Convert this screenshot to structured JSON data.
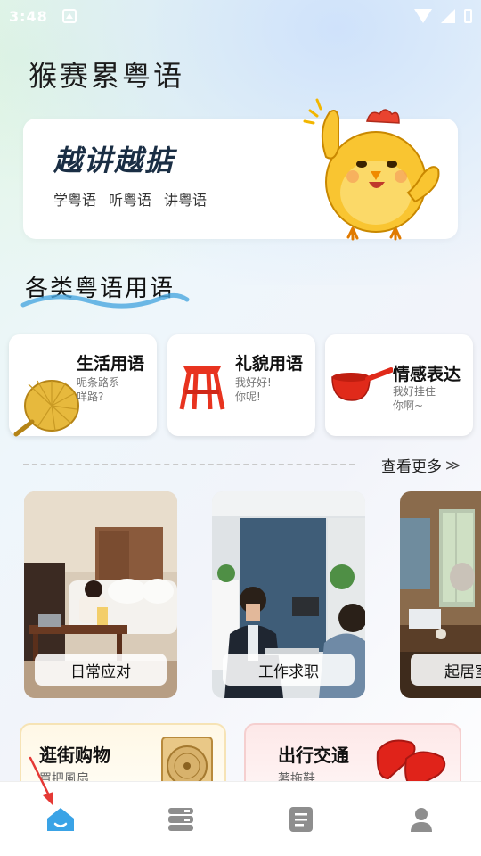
{
  "status_bar": {
    "time": "3:48"
  },
  "app": {
    "title": "猴赛累粤语"
  },
  "banner": {
    "slogan": "越讲越掂",
    "subs": [
      "学粤语",
      "听粤语",
      "讲粤语"
    ]
  },
  "section": {
    "title": "各类粤语用语"
  },
  "categories": [
    {
      "name": "生活用语",
      "desc_line1": "呢条路系",
      "desc_line2": "咩路?",
      "icon": "hand-fan-icon"
    },
    {
      "name": "礼貌用语",
      "desc_line1": "我好好!",
      "desc_line2": "你呢!",
      "icon": "red-stool-icon"
    },
    {
      "name": "情感表达",
      "desc_line1": "我好挂住",
      "desc_line2": "你啊~",
      "icon": "red-ladle-icon"
    }
  ],
  "more": {
    "label": "查看更多",
    "icon": "double-chevron-right-icon"
  },
  "scenes": [
    {
      "label": "日常应对"
    },
    {
      "label": "工作求职"
    },
    {
      "label": "起居室"
    }
  ],
  "topics": [
    {
      "title": "逛街购物",
      "sub": "買把風扇",
      "icon": "fan-icon"
    },
    {
      "title": "出行交通",
      "sub": "著拖鞋",
      "icon": "slippers-icon"
    }
  ],
  "nav": [
    {
      "icon": "home-icon",
      "active": true
    },
    {
      "icon": "books-icon",
      "active": false
    },
    {
      "icon": "document-icon",
      "active": false
    },
    {
      "icon": "profile-icon",
      "active": false
    }
  ],
  "colors": {
    "accent": "#3aa3e6",
    "nav_inactive": "#8e8e8e",
    "annotation_arrow": "#e53935"
  }
}
